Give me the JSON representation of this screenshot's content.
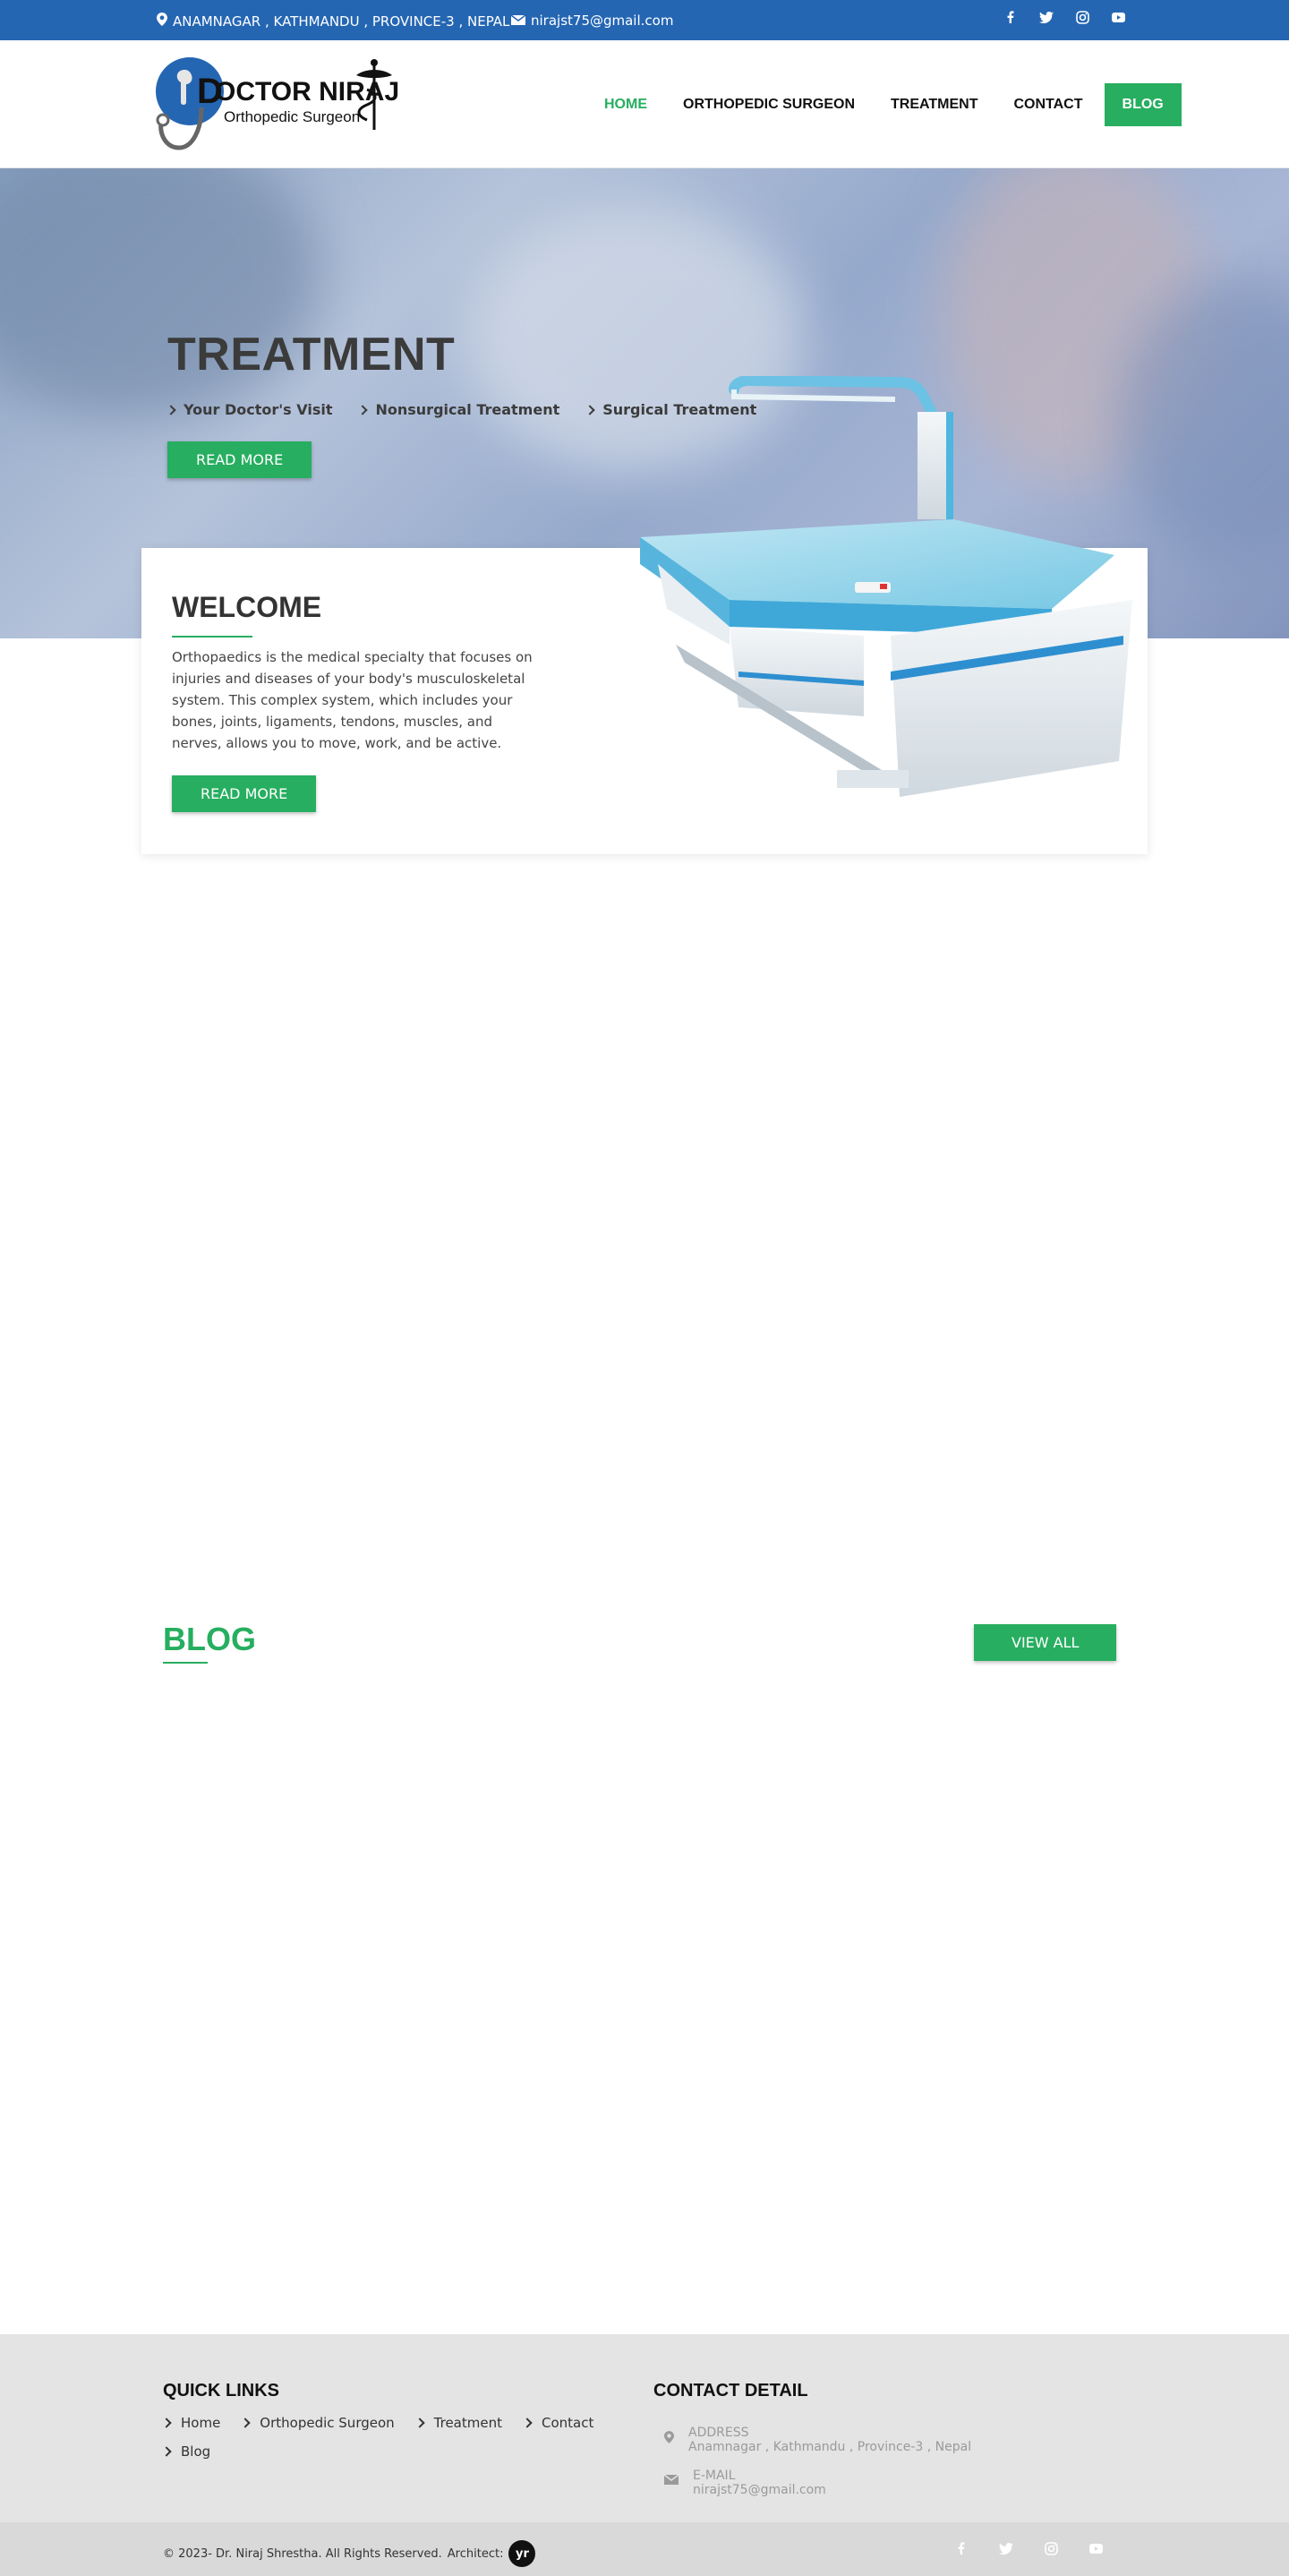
{
  "topbar": {
    "address": "ANAMNAGAR , KATHMANDU , PROVINCE-3 , NEPAL",
    "email": "nirajst75@gmail.com",
    "social_icons": [
      "facebook-icon",
      "twitter-icon",
      "instagram-icon",
      "youtube-icon"
    ]
  },
  "logo": {
    "name": "DOCTOR NIRAJ",
    "tagline": "Orthopedic Surgeon"
  },
  "nav": {
    "items": [
      {
        "label": "HOME",
        "active": true
      },
      {
        "label": "ORTHOPEDIC SURGEON"
      },
      {
        "label": "TREATMENT"
      },
      {
        "label": "CONTACT"
      },
      {
        "label": "BLOG"
      }
    ]
  },
  "hero": {
    "title": "TREATMENT",
    "links": [
      "Your Doctor's Visit",
      "Nonsurgical Treatment",
      "Surgical Treatment"
    ],
    "button": "READ MORE"
  },
  "welcome": {
    "title": "WELCOME",
    "text": "Orthopaedics is the medical specialty that focuses on injuries and diseases of your body's musculoskeletal system. This complex system, which includes your bones, joints, ligaments, tendons, muscles, and nerves, allows you to move, work, and be active.",
    "button": "READ MORE"
  },
  "blog": {
    "title": "BLOG",
    "view_all": "VIEW ALL"
  },
  "footer": {
    "quick_links_title": "QUICK LINKS",
    "quick_links": [
      "Home",
      "Orthopedic Surgeon",
      "Treatment",
      "Contact",
      "Blog"
    ],
    "contact_title": "CONTACT DETAIL",
    "address_label": "ADDRESS",
    "address_value": "Anamnagar , Kathmandu , Province-3 , Nepal",
    "email_label": "E-MAIL",
    "email_value": "nirajst75@gmail.com",
    "copyright": "© 2023- Dr. Niraj Shrestha. All Rights Reserved.",
    "architect": "Architect:",
    "architect_badge": "yr"
  },
  "colors": {
    "topbar": "#2566b3",
    "accent": "#27ae60"
  }
}
